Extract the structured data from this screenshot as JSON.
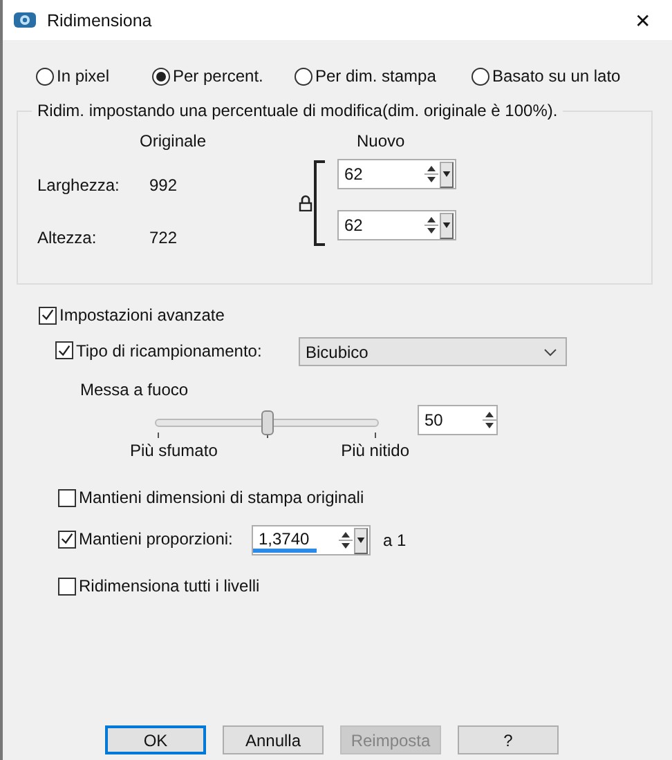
{
  "window": {
    "title": "Ridimensiona",
    "close": "✕"
  },
  "modes": [
    {
      "label": "In pixel",
      "selected": false
    },
    {
      "label": "Per percent.",
      "selected": true
    },
    {
      "label": "Per dim. stampa",
      "selected": false
    },
    {
      "label": "Basato su un lato",
      "selected": false
    }
  ],
  "group": {
    "title": "Ridim. impostando una percentuale di modifica(dim. originale è 100%).",
    "col_original": "Originale",
    "col_new": "Nuovo",
    "locked": true,
    "rows": [
      {
        "label": "Larghezza:",
        "original": "992",
        "value": "62"
      },
      {
        "label": "Altezza:",
        "original": "722",
        "value": "62"
      }
    ]
  },
  "advanced": {
    "label": "Impostazioni avanzate",
    "checked": true
  },
  "resample": {
    "label": "Tipo di ricampionamento:",
    "checked": true,
    "value": "Bicubico"
  },
  "focus": {
    "label": "Messa a fuoco",
    "level": 0.5,
    "min_label": "Più sfumato",
    "max_label": "Più nitido",
    "value": "50"
  },
  "options": [
    {
      "kind": "checkbox",
      "label": "Mantieni dimensioni di stampa originali",
      "checked": false
    },
    {
      "kind": "ratio",
      "label": "Mantieni proporzioni:",
      "checked": true,
      "value": "1,3740",
      "suffix": "a 1"
    },
    {
      "kind": "checkbox",
      "label": "Ridimensiona tutti i livelli",
      "checked": false
    }
  ],
  "buttons": [
    {
      "label": "OK",
      "default": true,
      "disabled": false
    },
    {
      "label": "Annulla",
      "default": false,
      "disabled": false
    },
    {
      "label": "Reimposta",
      "default": false,
      "disabled": true
    },
    {
      "label": "?",
      "default": false,
      "disabled": false
    }
  ]
}
